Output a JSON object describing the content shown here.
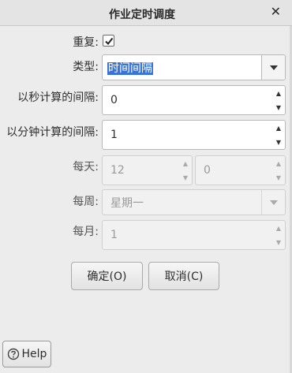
{
  "dialog": {
    "title": "作业定时调度",
    "close_glyph": "✕"
  },
  "form": {
    "repeat": {
      "label": "重复:",
      "checked": true
    },
    "type": {
      "label": "类型:",
      "value": "时间间隔"
    },
    "interval_seconds": {
      "label": "以秒计算的间隔:",
      "value": "0"
    },
    "interval_minutes": {
      "label": "以分钟计算的间隔:",
      "value": "1"
    },
    "daily": {
      "label": "每天:",
      "hour": "12",
      "minute": "0"
    },
    "weekly": {
      "label": "每周:",
      "value": "星期一"
    },
    "monthly": {
      "label": "每月:",
      "value": "1"
    }
  },
  "buttons": {
    "ok": "确定(O)",
    "cancel": "取消(C)",
    "help": "Help"
  },
  "icons": {
    "checkbox": "checkmark-icon",
    "combo": "chevron-down-icon",
    "spin_up": "spin-up-icon",
    "spin_down": "spin-down-icon",
    "help": "question-icon"
  }
}
